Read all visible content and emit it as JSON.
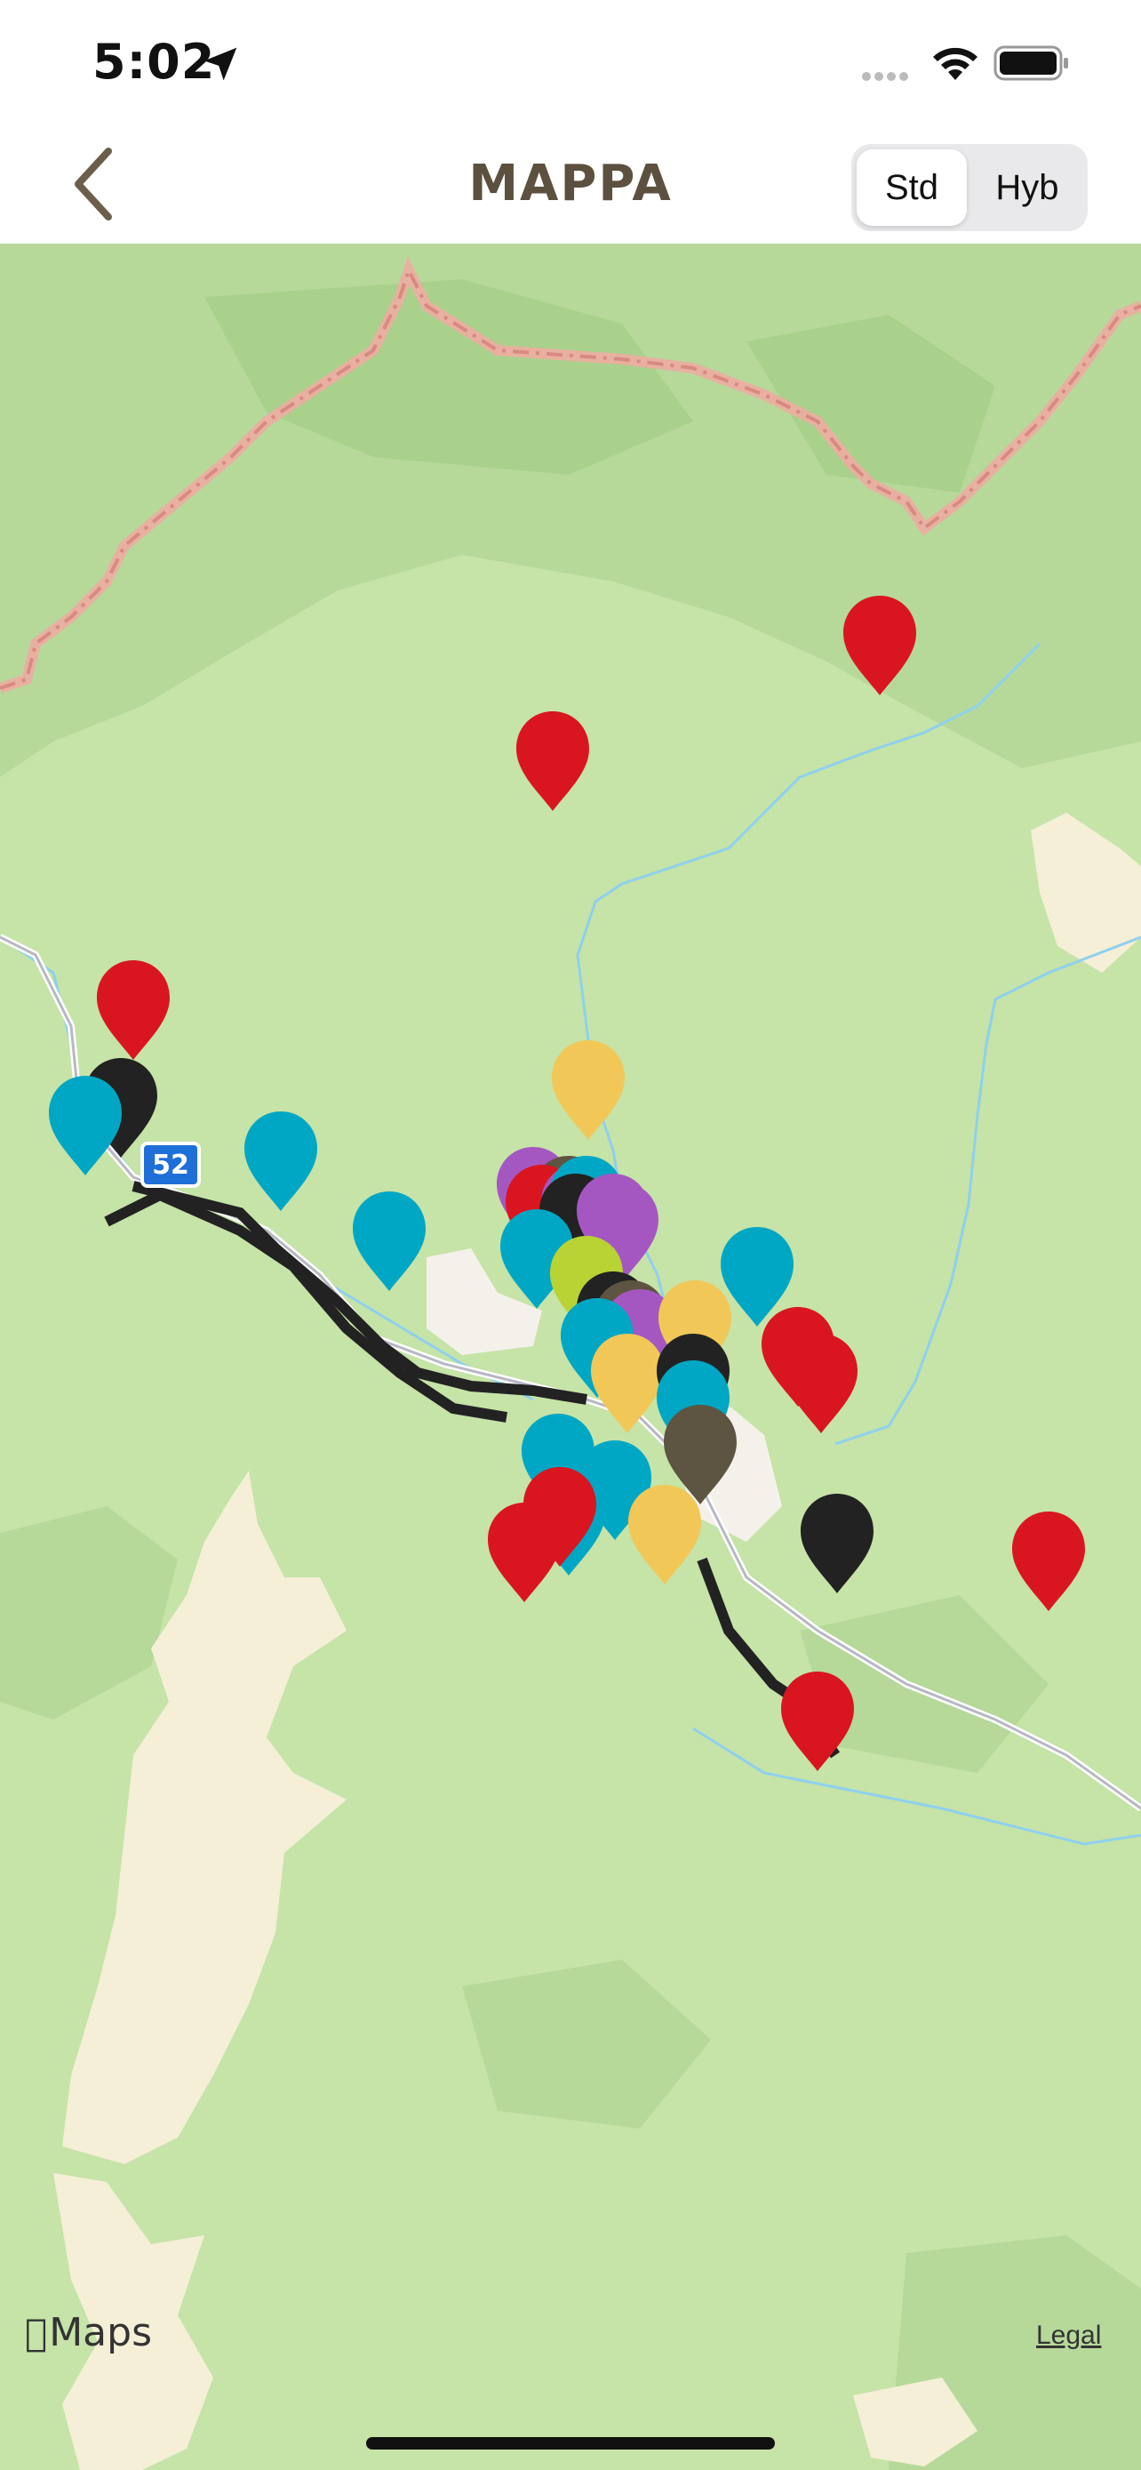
{
  "status_bar": {
    "time": "5:02"
  },
  "nav": {
    "title": "MAPPA",
    "segments": [
      "Std",
      "Hyb"
    ],
    "selected_segment": "Std"
  },
  "map": {
    "road_badge": "52",
    "logo_text": "Maps",
    "legal": "Legal"
  },
  "pin_colors": {
    "red": "#d9161f",
    "teal": "#00a7c4",
    "black": "#222222",
    "yellow": "#f1c857",
    "purple": "#a557c1",
    "olive": "#5e5442",
    "lime": "#b9d334"
  }
}
